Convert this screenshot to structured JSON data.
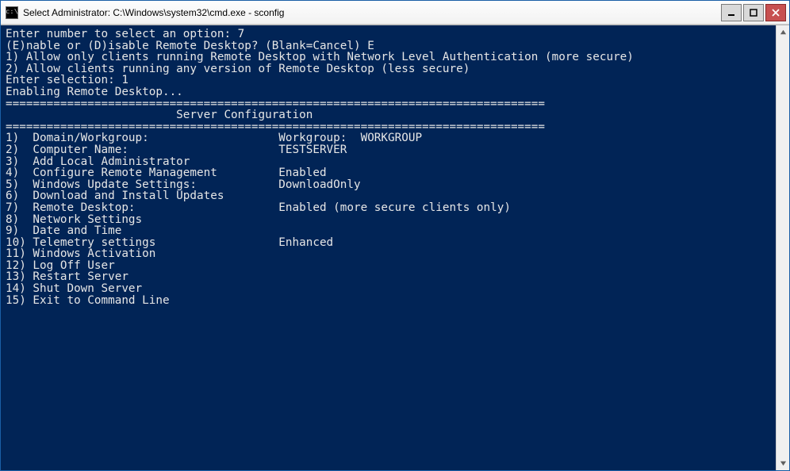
{
  "window": {
    "title": "Select Administrator: C:\\Windows\\system32\\cmd.exe - sconfig",
    "icon_label": "c:\\"
  },
  "console": {
    "pre_lines": [
      "Enter number to select an option: 7",
      "",
      "",
      "(E)nable or (D)isable Remote Desktop? (Blank=Cancel) E",
      "",
      "1) Allow only clients running Remote Desktop with Network Level Authentication (more secure)",
      "",
      "2) Allow clients running any version of Remote Desktop (less secure)",
      "",
      "Enter selection: 1",
      "",
      "Enabling Remote Desktop...",
      "",
      "===============================================================================",
      "                         Server Configuration",
      "==============================================================================="
    ],
    "menu_rows": [
      {
        "num": "1)",
        "label": "Domain/Workgroup:",
        "value": "Workgroup:  WORKGROUP"
      },
      {
        "num": "2)",
        "label": "Computer Name:",
        "value": "TESTSERVER"
      },
      {
        "num": "3)",
        "label": "Add Local Administrator",
        "value": ""
      },
      {
        "num": "4)",
        "label": "Configure Remote Management",
        "value": "Enabled"
      },
      {
        "num": "",
        "label": "",
        "value": ""
      },
      {
        "num": "5)",
        "label": "Windows Update Settings:",
        "value": "DownloadOnly"
      },
      {
        "num": "6)",
        "label": "Download and Install Updates",
        "value": ""
      },
      {
        "num": "7)",
        "label": "Remote Desktop:",
        "value": "Enabled (more secure clients only)"
      },
      {
        "num": "",
        "label": "",
        "value": ""
      },
      {
        "num": "8)",
        "label": "Network Settings",
        "value": ""
      },
      {
        "num": "9)",
        "label": "Date and Time",
        "value": ""
      },
      {
        "num": "10)",
        "label": "Telemetry settings",
        "value": "Enhanced"
      },
      {
        "num": "11)",
        "label": "Windows Activation",
        "value": ""
      },
      {
        "num": "",
        "label": "",
        "value": ""
      },
      {
        "num": "12)",
        "label": "Log Off User",
        "value": ""
      },
      {
        "num": "13)",
        "label": "Restart Server",
        "value": ""
      },
      {
        "num": "14)",
        "label": "Shut Down Server",
        "value": ""
      },
      {
        "num": "15)",
        "label": "Exit to Command Line",
        "value": ""
      }
    ],
    "layout": {
      "label_col_start": 4,
      "value_col_start": 40
    }
  }
}
